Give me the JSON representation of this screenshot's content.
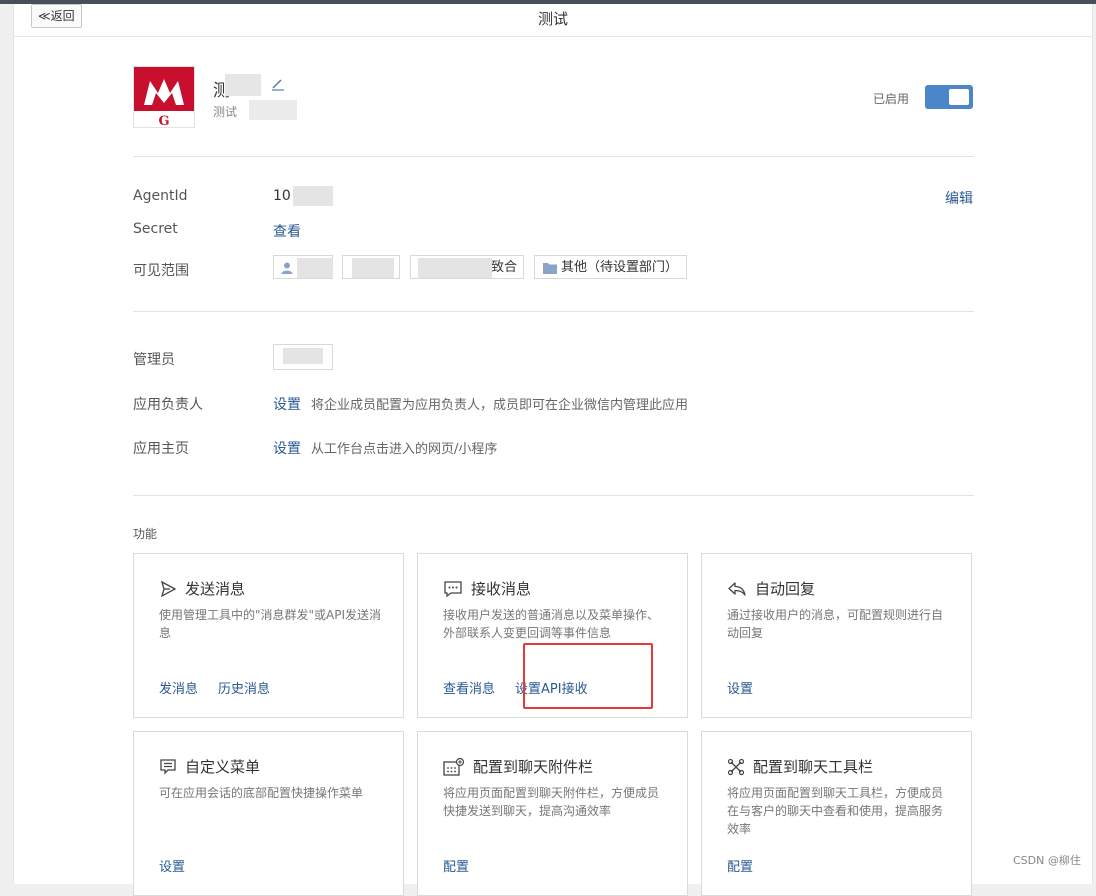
{
  "header": {
    "back_label": "≪返回",
    "title": "测试"
  },
  "app": {
    "name": "测",
    "desc": "测试",
    "status_label": "已启用",
    "enabled": true
  },
  "info": {
    "agentid_label": "AgentId",
    "agentid_value": "10",
    "edit_link": "编辑",
    "secret_label": "Secret",
    "secret_link": "查看",
    "visible_label": "可见范围",
    "visible_chip_partial": "致合",
    "visible_chip_other": "其他（待设置部门）"
  },
  "manage": {
    "admin_label": "管理员",
    "owner_label": "应用负责人",
    "owner_link": "设置",
    "owner_hint": "将企业成员配置为应用负责人，成员即可在企业微信内管理此应用",
    "home_label": "应用主页",
    "home_link": "设置",
    "home_hint": "从工作台点击进入的网页/小程序"
  },
  "features": {
    "title": "功能",
    "cards": [
      {
        "title": "发送消息",
        "desc": "使用管理工具中的\"消息群发\"或API发送消息",
        "links": [
          "发消息",
          "历史消息"
        ],
        "icon": "send-icon"
      },
      {
        "title": "接收消息",
        "desc": "接收用户发送的普通消息以及菜单操作、外部联系人变更回调等事件信息",
        "links": [
          "查看消息",
          "设置API接收"
        ],
        "icon": "message-icon"
      },
      {
        "title": "自动回复",
        "desc": "通过接收用户的消息，可配置规则进行自动回复",
        "links": [
          "设置"
        ],
        "icon": "reply-icon"
      },
      {
        "title": "自定义菜单",
        "desc": "可在应用会话的底部配置快捷操作菜单",
        "links": [
          "设置"
        ],
        "icon": "menu-icon"
      },
      {
        "title": "配置到聊天附件栏",
        "desc": "将应用页面配置到聊天附件栏，方便成员快捷发送到聊天，提高沟通效率",
        "links": [
          "配置"
        ],
        "icon": "attachment-bar-icon"
      },
      {
        "title": "配置到聊天工具栏",
        "desc": "将应用页面配置到聊天工具栏，方便成员在与客户的聊天中查看和使用，提高服务效率",
        "links": [
          "配置"
        ],
        "icon": "toolbar-icon"
      }
    ]
  },
  "watermark": "CSDN @柳住",
  "colors": {
    "link": "#2a5a93",
    "toggle": "#4a86c8",
    "highlight": "#e53935",
    "logo": "#c8102e"
  }
}
